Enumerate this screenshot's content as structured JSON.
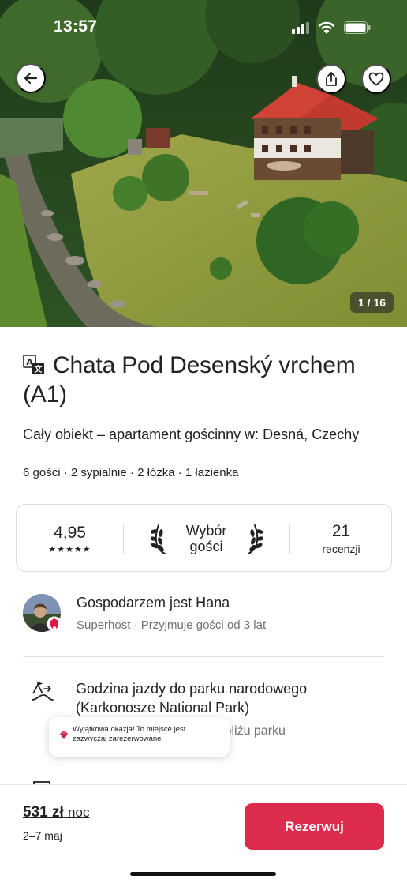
{
  "status_bar": {
    "time": "13:57"
  },
  "hero": {
    "photo_counter": "1 / 16",
    "icons": {
      "back": "arrow-left-icon",
      "share": "share-icon",
      "favorite": "heart-icon"
    }
  },
  "listing": {
    "title": "Chata Pod Desenský vrchem (A1)",
    "subtitle": "Cały obiekt – apartament gościnny w: Desná, Czechy",
    "details": "6 gości · 2 sypialnie · 2 łóżka · 1 łazienka"
  },
  "rating_card": {
    "rating": "4,95",
    "stars": "★★★★★",
    "guest_favorite": "Wybór gości",
    "review_count": "21",
    "review_label": "recenzji"
  },
  "host": {
    "name": "Gospodarzem jest Hana",
    "sub": "Superhost · Przyjmuje gości od 3 lat"
  },
  "highlights": [
    {
      "icon": "mountain-route-icon",
      "title": "Godzina jazdy do parku narodowego (Karkonosze National Park)",
      "sub": "Ten dom znajduje się w pobliżu parku"
    }
  ],
  "toast": {
    "icon": "gem-icon",
    "text": "Wyjątkowa okazja! To miejsce jest zazwyczaj zarezerwowane"
  },
  "booking": {
    "price": "531 zł",
    "price_unit": "noc",
    "dates": "2–7 maj",
    "reserve_label": "Rezerwuj"
  },
  "colors": {
    "accent": "#dd2b4e",
    "text": "#222222",
    "muted": "#717171",
    "border": "#dddddd"
  }
}
